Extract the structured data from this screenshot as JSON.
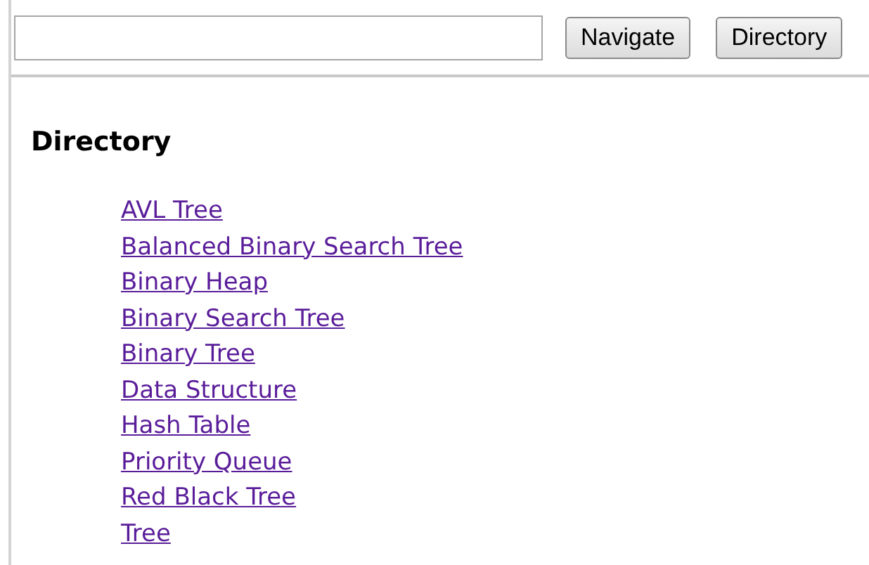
{
  "toolbar": {
    "buttons": [
      "Navigate",
      "Directory"
    ]
  },
  "heading": "Directory",
  "links": [
    {
      "label": "AVL Tree"
    },
    {
      "label": "Balanced Binary Search Tree"
    },
    {
      "label": "Binary Heap"
    },
    {
      "label": "Binary Search Tree"
    },
    {
      "label": "Binary Tree"
    },
    {
      "label": "Data Structure"
    },
    {
      "label": "Hash Table"
    },
    {
      "label": "Priority Queue"
    },
    {
      "label": "Red Black Tree"
    },
    {
      "label": "Tree"
    }
  ]
}
